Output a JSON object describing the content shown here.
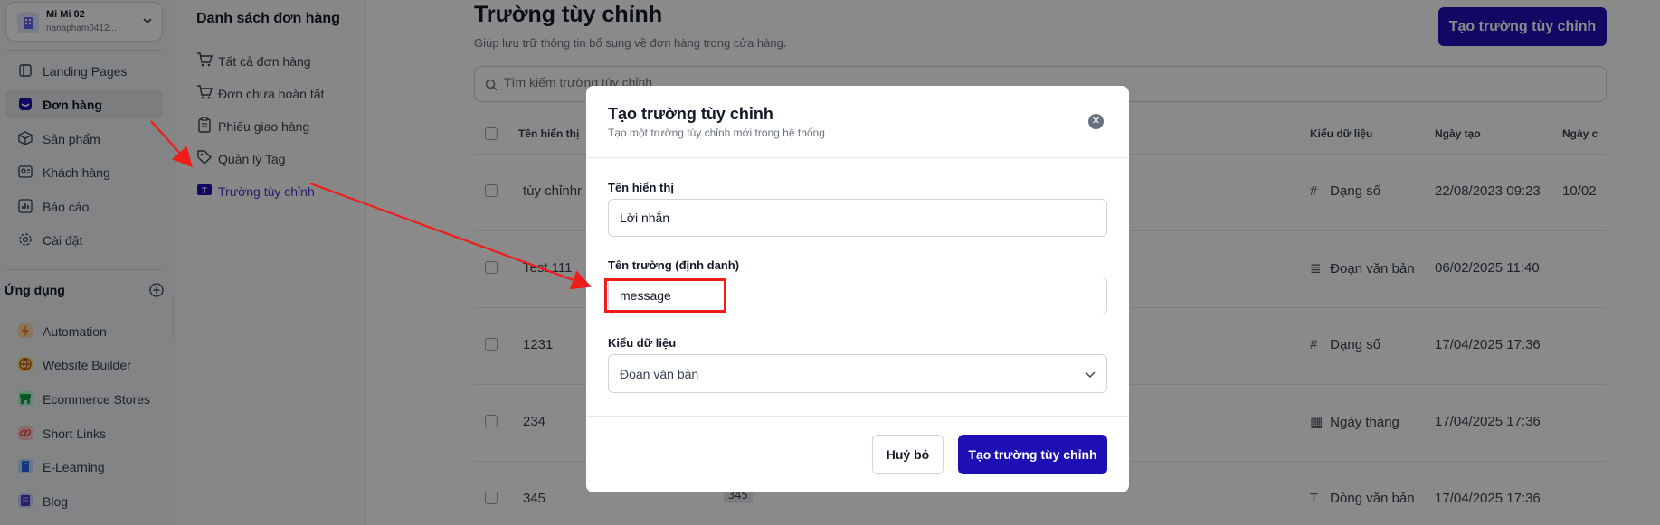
{
  "workspace": {
    "name": "Mi Mi 02",
    "email": "nanapham0412..."
  },
  "sidebar": {
    "nav": [
      {
        "label": "Landing Pages",
        "icon": "landing-pages-icon"
      },
      {
        "label": "Đơn hàng",
        "icon": "orders-icon"
      },
      {
        "label": "Sản phẩm",
        "icon": "product-box-icon"
      },
      {
        "label": "Khách hàng",
        "icon": "customers-icon"
      },
      {
        "label": "Báo cáo",
        "icon": "report-icon"
      },
      {
        "label": "Cài đặt",
        "icon": "gear-icon"
      }
    ],
    "apps_title": "Ứng dụng",
    "apps": [
      {
        "label": "Automation",
        "color": "#f97316"
      },
      {
        "label": "Website Builder",
        "color": "#b45309"
      },
      {
        "label": "Ecommerce Stores",
        "color": "#16a34a"
      },
      {
        "label": "Short Links",
        "color": "#ef4444"
      },
      {
        "label": "E-Learning",
        "color": "#2563eb"
      },
      {
        "label": "Blog",
        "color": "#4338ca"
      }
    ]
  },
  "submenu": {
    "title": "Danh sách đơn hàng",
    "items": [
      {
        "label": "Tất cả đơn hàng"
      },
      {
        "label": "Đơn chưa hoàn tất"
      },
      {
        "label": "Phiếu giao hàng"
      },
      {
        "label": "Quản lý Tag"
      },
      {
        "label": "Trường tùy chỉnh"
      }
    ]
  },
  "page": {
    "title": "Trường tùy chỉnh",
    "subtitle": "Giúp lưu trữ thông tin bổ sung về đơn hàng trong cửa hàng.",
    "create_button": "Tạo trường tùy chỉnh",
    "search_placeholder": "Tìm kiếm trường tùy chỉnh"
  },
  "table": {
    "columns": [
      "Tên hiển thị",
      "Kiểu dữ liệu",
      "Ngày tạo",
      "Ngày c"
    ],
    "rows": [
      {
        "name": "tùy chỉnhr",
        "code": "",
        "type": "Dạng số",
        "type_icon": "#",
        "created": "22/08/2023 09:23",
        "updated": "10/02"
      },
      {
        "name": "Test 111",
        "code": "",
        "type": "Đoạn văn bản",
        "type_icon": "≣",
        "created": "06/02/2025 11:40",
        "updated": ""
      },
      {
        "name": "1231",
        "code": "",
        "type": "Dạng số",
        "type_icon": "#",
        "created": "17/04/2025 17:36",
        "updated": ""
      },
      {
        "name": "234",
        "code": "",
        "type": "Ngày tháng",
        "type_icon": "▦",
        "created": "17/04/2025 17:36",
        "updated": ""
      },
      {
        "name": "345",
        "code": "345",
        "type": "Dòng văn bản",
        "type_icon": "T",
        "created": "17/04/2025 17:36",
        "updated": ""
      }
    ]
  },
  "modal": {
    "title": "Tạo trường tùy chỉnh",
    "subtitle": "Tạo một trường tùy chỉnh mới trong hệ thống",
    "display_name_label": "Tên hiển thị",
    "display_name_value": "Lời nhắn",
    "field_name_label": "Tên trường (định danh)",
    "field_name_value": "message",
    "data_type_label": "Kiểu dữ liệu",
    "data_type_value": "Đoạn văn bản",
    "cancel_label": "Huỷ bỏ",
    "submit_label": "Tạo trường tùy chỉnh"
  },
  "colors": {
    "brand": "#1e0fb5",
    "annotation": "#ef1c1c"
  }
}
